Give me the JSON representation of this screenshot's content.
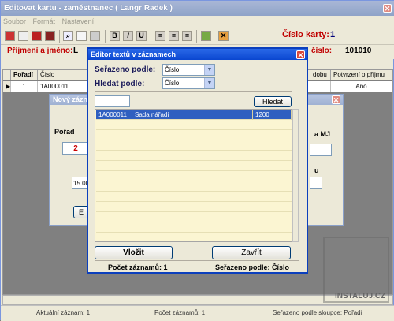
{
  "main": {
    "title": "Editovat kartu - zaměstnanec ( Langr Radek )",
    "menu": [
      "Soubor",
      "Formát",
      "Nastavení"
    ],
    "card_number_label": "Číslo karty:",
    "card_number": "1",
    "name_label": "Příjmení a jméno:",
    "name_value": "L",
    "personal_number_label": "číslo:",
    "personal_number": "101010",
    "grid_headers": [
      "Pořadí",
      "Číslo",
      "dobu",
      "Potvrzení o příjmu"
    ],
    "grid_row": {
      "order": "1",
      "number": "1A000011",
      "confirmation": "Ano"
    },
    "status": {
      "current_record": "Aktuální záznam: 1",
      "record_count": "Počet záznamů: 1",
      "sorted_by": "Seřazeno podle sloupce: Pořadí"
    }
  },
  "mid_dialog": {
    "title": "Nový zázn",
    "order_label": "Pořad",
    "order_value": "2",
    "mj_label": "a MJ",
    "price_value": "15.00",
    "right_label": "u",
    "button_partial": "E"
  },
  "editor": {
    "title": "Editor textů v záznamech",
    "sort_label": "Seřazeno podle:",
    "sort_value": "Číslo",
    "search_label": "Hledat podle:",
    "search_value": "Číslo",
    "search_button": "Hledat",
    "rows": [
      {
        "code": "1A000011",
        "name": "Sada nářadí",
        "number": "1200"
      }
    ],
    "insert_button": "Vložit",
    "close_button": "Zavřít",
    "record_count": "Počet záznamů: 1",
    "sorted_by": "Seřazeno podle: Číslo"
  },
  "watermark": "INSTALUJ.CZ"
}
